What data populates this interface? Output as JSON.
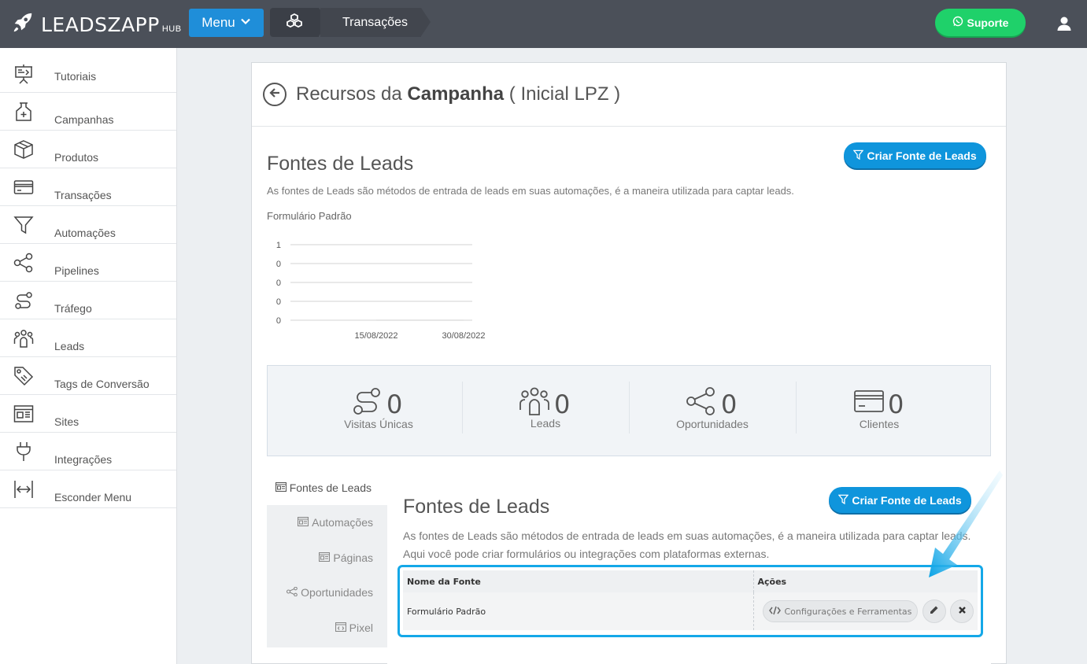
{
  "topbar": {
    "brand_name": "LEADSZAPP",
    "brand_suffix": "HUB",
    "menu_label": "Menu",
    "breadcrumb_current": "Transações",
    "support_label": "Suporte"
  },
  "sidebar": {
    "items": [
      {
        "label": "Tutoriais",
        "icon": "presentation-icon"
      },
      {
        "label": "Campanhas",
        "icon": "flask-icon"
      },
      {
        "label": "Produtos",
        "icon": "box-icon"
      },
      {
        "label": "Transações",
        "icon": "credit-card-icon"
      },
      {
        "label": "Automações",
        "icon": "funnel-icon"
      },
      {
        "label": "Pipelines",
        "icon": "share-icon"
      },
      {
        "label": "Tráfego",
        "icon": "route-icon"
      },
      {
        "label": "Leads",
        "icon": "users-icon"
      },
      {
        "label": "Tags de Conversão",
        "icon": "tags-icon"
      },
      {
        "label": "Sites",
        "icon": "website-icon"
      },
      {
        "label": "Integrações",
        "icon": "plug-icon"
      },
      {
        "label": "Esconder Menu",
        "icon": "collapse-icon"
      }
    ]
  },
  "page": {
    "title_prefix": "Recursos da ",
    "title_bold": "Campanha",
    "title_suffix": " ( Inicial LPZ )"
  },
  "leads_section": {
    "title": "Fontes de Leads",
    "description": "As fontes de Leads são métodos de entrada de leads em suas automações, é a maneira utilizada para captar leads.",
    "create_button": "Criar Fonte de Leads",
    "chart_title": "Formulário Padrão"
  },
  "chart_data": {
    "type": "line",
    "title": "Formulário Padrão",
    "x": [
      "15/08/2022",
      "30/08/2022"
    ],
    "y_tick_labels": [
      "1",
      "0",
      "0",
      "0",
      "0"
    ],
    "series": [
      {
        "values": [
          0,
          0
        ]
      }
    ],
    "ylim": [
      0,
      1
    ],
    "grid": true,
    "xlabel": "",
    "ylabel": ""
  },
  "stats": [
    {
      "value": "0",
      "label": "Visitas Únicas",
      "icon": "route-icon"
    },
    {
      "value": "0",
      "label": "Leads",
      "icon": "users-icon"
    },
    {
      "value": "0",
      "label": "Oportunidades",
      "icon": "share-icon"
    },
    {
      "value": "0",
      "label": "Clientes",
      "icon": "credit-card-icon"
    }
  ],
  "tabs": [
    {
      "label": "Fontes de Leads",
      "active": true
    },
    {
      "label": "Automações",
      "active": false
    },
    {
      "label": "Páginas",
      "active": false
    },
    {
      "label": "Oportunidades",
      "active": false
    },
    {
      "label": "Pixel",
      "active": false
    }
  ],
  "tab_pane": {
    "title": "Fontes de Leads",
    "description": "As fontes de Leads são métodos de entrada de leads em suas automações, é a maneira utilizada para captar leads. Aqui você pode criar formulários ou integrações com plataformas externas.",
    "create_button": "Criar Fonte de Leads",
    "table": {
      "headers": [
        "Nome da Fonte",
        "Ações"
      ],
      "rows": [
        {
          "name": "Formulário Padrão",
          "config_button": "Configurações e Ferramentas"
        }
      ]
    }
  },
  "colors": {
    "topbar": "#4b5059",
    "primary": "#1f8ed9",
    "support": "#1fd16a",
    "highlight": "#14a8e8"
  }
}
